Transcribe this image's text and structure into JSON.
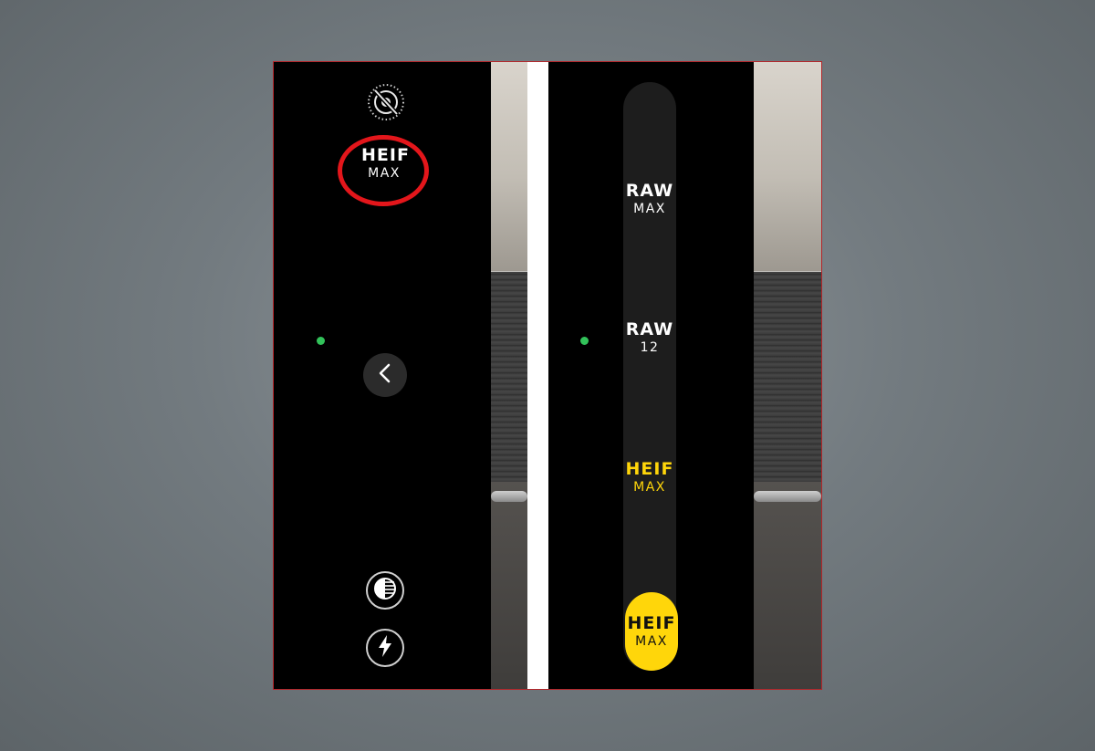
{
  "left_panel": {
    "format_button": {
      "line1": "HEIF",
      "line2": "MAX"
    },
    "icons": {
      "live_photo": "live-photo-off-icon",
      "back": "chevron-left-icon",
      "exposure": "exposure-icon",
      "flash": "flash-icon"
    },
    "highlight_color": "#e3161b"
  },
  "right_panel": {
    "format_options": [
      {
        "line1": "RAW",
        "line2": "MAX",
        "color": "#ffffff"
      },
      {
        "line1": "RAW",
        "line2": "12",
        "color": "#ffffff"
      },
      {
        "line1": "HEIF",
        "line2": "MAX",
        "color": "#ffd60a"
      }
    ],
    "selected": {
      "line1": "HEIF",
      "line2": "MAX"
    },
    "accent_color": "#ffd60a"
  },
  "status_indicator_color": "#32c25a"
}
